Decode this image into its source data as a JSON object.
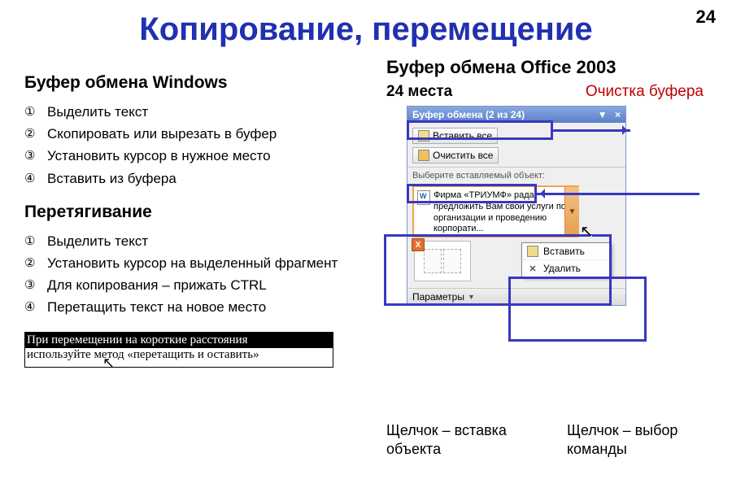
{
  "page_number": "24",
  "title": "Копирование, перемещение",
  "left": {
    "heading1": "Буфер обмена Windows",
    "list1": [
      "Выделить текст",
      "Скопировать или вырезать в буфер",
      "Установить курсор в нужное место",
      "Вставить из буфера"
    ],
    "heading2": "Перетягивание",
    "list2": [
      "Выделить текст",
      "Установить курсор на выделенный фрагмент",
      "Для копирования – прижать CTRL",
      "Перетащить текст на новое место"
    ],
    "tip_highlight": "При перемещении на короткие расстояния",
    "tip_rest": "используйте метод «перетащить и оставить»"
  },
  "right": {
    "heading": "Буфер обмена Office 2003",
    "places_label": "24 места",
    "clear_label": "Очистка буфера",
    "pane_title": "Буфер обмена (2 из 24)",
    "paste_all": "Вставить все",
    "clear_all": "Очистить все",
    "choose_hint": "Выберите вставляемый объект:",
    "item_text": "Фирма «ТРИУМФ» рада предложить Вам свои услуги по организации и проведению корпорати...",
    "menu_paste": "Вставить",
    "menu_delete": "Удалить",
    "params": "Параметры",
    "caption1": "Щелчок – вставка объекта",
    "caption2": "Щелчок – выбор команды"
  },
  "circled_nums": [
    "①",
    "②",
    "③",
    "④"
  ]
}
